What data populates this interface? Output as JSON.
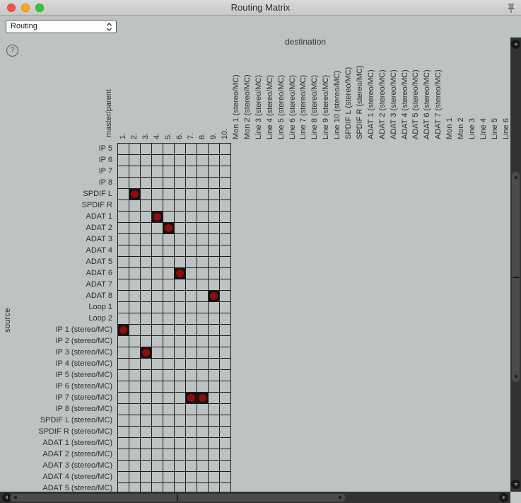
{
  "window": {
    "title": "Routing Matrix"
  },
  "titlebar": {
    "close_icon": "close",
    "minimize_icon": "minimize",
    "zoom_icon": "zoom",
    "pin_icon": "push-pin"
  },
  "toolbar": {
    "preset_select": {
      "value": "Routing"
    },
    "help_label": "?"
  },
  "axis": {
    "destination_label": "destination",
    "source_label": "source",
    "master_parent_label": "master/parent"
  },
  "matrix": {
    "column_headers": [
      "1.",
      "2.",
      "3.",
      "4.",
      "5.",
      "6.",
      "7.",
      "8.",
      "9.",
      "10.",
      "Mon 1 (stereo/MC)",
      "Mon 2 (stereo/MC)",
      "Line 3 (stereo/MC)",
      "Line 4 (stereo/MC)",
      "Line 5 (stereo/MC)",
      "Line 6 (stereo/MC)",
      "Line 7 (stereo/MC)",
      "Line 8 (stereo/MC)",
      "Line 9 (stereo/MC)",
      "Line 10 (stereo/MC)",
      "SPDIF L (stereo/MC)",
      "SPDIF R (stereo/MC)",
      "ADAT 1 (stereo/MC)",
      "ADAT 2 (stereo/MC)",
      "ADAT 3 (stereo/MC)",
      "ADAT 4 (stereo/MC)",
      "ADAT 5 (stereo/MC)",
      "ADAT 6 (stereo/MC)",
      "ADAT 7 (stereo/MC)",
      "Mon 1",
      "Mon 2",
      "Line 3",
      "Line 4",
      "Line 5",
      "Line 6"
    ],
    "row_headers": [
      "IP 5",
      "IP 6",
      "IP 7",
      "IP 8",
      "SPDIF L",
      "SPDIF R",
      "ADAT 1",
      "ADAT 2",
      "ADAT 3",
      "ADAT 4",
      "ADAT 5",
      "ADAT 6",
      "ADAT 7",
      "ADAT 8",
      "Loop 1",
      "Loop 2",
      "IP 1 (stereo/MC)",
      "IP 2 (stereo/MC)",
      "IP 3 (stereo/MC)",
      "IP 4 (stereo/MC)",
      "IP 5 (stereo/MC)",
      "IP 6 (stereo/MC)",
      "IP 7 (stereo/MC)",
      "IP 8 (stereo/MC)",
      "SPDIF L (stereo/MC)",
      "SPDIF R (stereo/MC)",
      "ADAT 1 (stereo/MC)",
      "ADAT 2 (stereo/MC)",
      "ADAT 3 (stereo/MC)",
      "ADAT 4 (stereo/MC)",
      "ADAT 5 (stereo/MC)"
    ],
    "grid_columns": 10,
    "marks": [
      {
        "row": 4,
        "col": 1,
        "row_label": "SPDIF L",
        "col_label": "2."
      },
      {
        "row": 6,
        "col": 3,
        "row_label": "ADAT 1",
        "col_label": "4."
      },
      {
        "row": 7,
        "col": 4,
        "row_label": "ADAT 2",
        "col_label": "5."
      },
      {
        "row": 11,
        "col": 5,
        "row_label": "ADAT 6",
        "col_label": "6."
      },
      {
        "row": 13,
        "col": 8,
        "row_label": "ADAT 8",
        "col_label": "9."
      },
      {
        "row": 16,
        "col": 0,
        "row_label": "IP 1 (stereo/MC)",
        "col_label": "1."
      },
      {
        "row": 18,
        "col": 2,
        "row_label": "IP 3 (stereo/MC)",
        "col_label": "3."
      },
      {
        "row": 22,
        "col": 6,
        "row_label": "IP 7 (stereo/MC)",
        "col_label": "7."
      },
      {
        "row": 22,
        "col": 7,
        "row_label": "IP 7 (stereo/MC)",
        "col_label": "8."
      }
    ]
  },
  "colors": {
    "window_bg": "#bdc2c2",
    "grid_line": "#1c1c1c",
    "mark_bg": "#141414",
    "mark_red": "#8e0c0c"
  },
  "scrollbars": {
    "vertical": {
      "up_icon": "arrow-up",
      "down_icon": "arrow-down"
    },
    "horizontal": {
      "left_icon": "arrow-left",
      "right_icon": "arrow-right"
    }
  }
}
